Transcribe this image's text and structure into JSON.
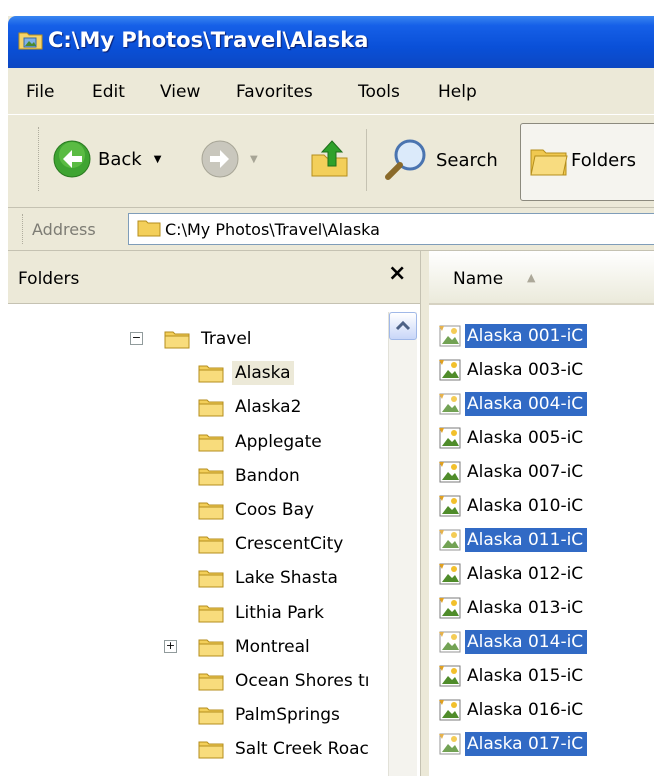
{
  "window": {
    "title": "C:\\My Photos\\Travel\\Alaska"
  },
  "menu": [
    "File",
    "Edit",
    "View",
    "Favorites",
    "Tools",
    "Help"
  ],
  "toolbar": {
    "back_label": "Back",
    "search_label": "Search",
    "folders_label": "Folders"
  },
  "address": {
    "label": "Address",
    "value": "C:\\My Photos\\Travel\\Alaska"
  },
  "folders_pane": {
    "title": "Folders",
    "close_glyph": "×",
    "tree": [
      {
        "label": "Travel",
        "expander": "−",
        "level": 0
      },
      {
        "label": "Alaska",
        "selected": true,
        "level": 1
      },
      {
        "label": "Alaska2",
        "level": 1
      },
      {
        "label": "Applegate",
        "level": 1
      },
      {
        "label": "Bandon",
        "level": 1
      },
      {
        "label": "Coos Bay",
        "level": 1
      },
      {
        "label": "CrescentCity",
        "level": 1
      },
      {
        "label": "Lake Shasta",
        "level": 1
      },
      {
        "label": "Lithia Park",
        "level": 1
      },
      {
        "label": "Montreal",
        "expander": "+",
        "level": 1
      },
      {
        "label": "Ocean Shores tı",
        "level": 1
      },
      {
        "label": "PalmSprings",
        "level": 1
      },
      {
        "label": "Salt Creek Roac",
        "level": 1
      }
    ]
  },
  "files_pane": {
    "column_name": "Name",
    "files": [
      {
        "name": "Alaska 001-iC",
        "selected": true
      },
      {
        "name": "Alaska 003-iC",
        "selected": false
      },
      {
        "name": "Alaska 004-iC",
        "selected": true
      },
      {
        "name": "Alaska 005-iC",
        "selected": false
      },
      {
        "name": "Alaska 007-iC",
        "selected": false
      },
      {
        "name": "Alaska 010-iC",
        "selected": false
      },
      {
        "name": "Alaska 011-iC",
        "selected": true
      },
      {
        "name": "Alaska 012-iC",
        "selected": false
      },
      {
        "name": "Alaska 013-iC",
        "selected": false
      },
      {
        "name": "Alaska 014-iC",
        "selected": true
      },
      {
        "name": "Alaska 015-iC",
        "selected": false
      },
      {
        "name": "Alaska 016-iC",
        "selected": false
      },
      {
        "name": "Alaska 017-iC",
        "selected": true
      }
    ]
  },
  "colors": {
    "titlebar": "#0a50d8",
    "selection": "#316ac5",
    "chrome": "#ece9d8"
  },
  "icons": {
    "title": "folder-photo-icon",
    "back": "back-arrow-icon",
    "forward": "forward-arrow-icon",
    "up": "up-folder-icon",
    "search": "magnifier-icon",
    "folders": "folders-icon",
    "folder": "folder-icon",
    "image_file": "image-file-icon"
  }
}
